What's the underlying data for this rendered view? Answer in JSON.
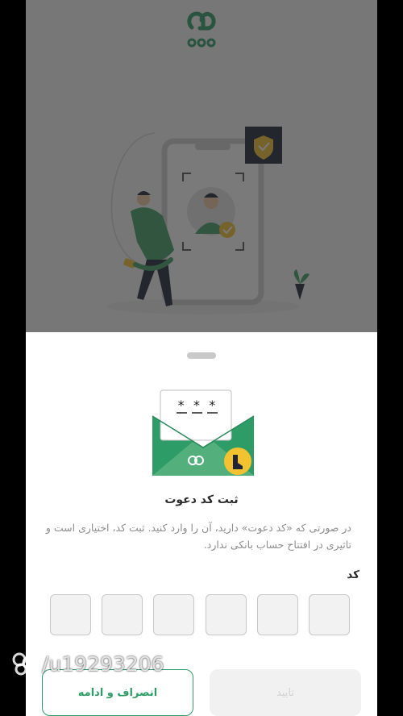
{
  "dialog": {
    "title": "ثبت کد دعوت",
    "description": "در صورتی که «کد دعوت» دارید، آن را وارد کنید. ثبت کد، اختیاری است و تاثیری در افتتاح حساب بانکی ندارد.",
    "code_label": "کد",
    "code_boxes": [
      "",
      "",
      "",
      "",
      "",
      ""
    ],
    "envelope_stars": "* * *"
  },
  "buttons": {
    "confirm_label": "تایید",
    "skip_label": "انصراف و ادامه"
  },
  "watermark": {
    "text": "/u19293206"
  },
  "colors": {
    "brand": "#2e9c66",
    "overlay": "#3a3a3a"
  }
}
